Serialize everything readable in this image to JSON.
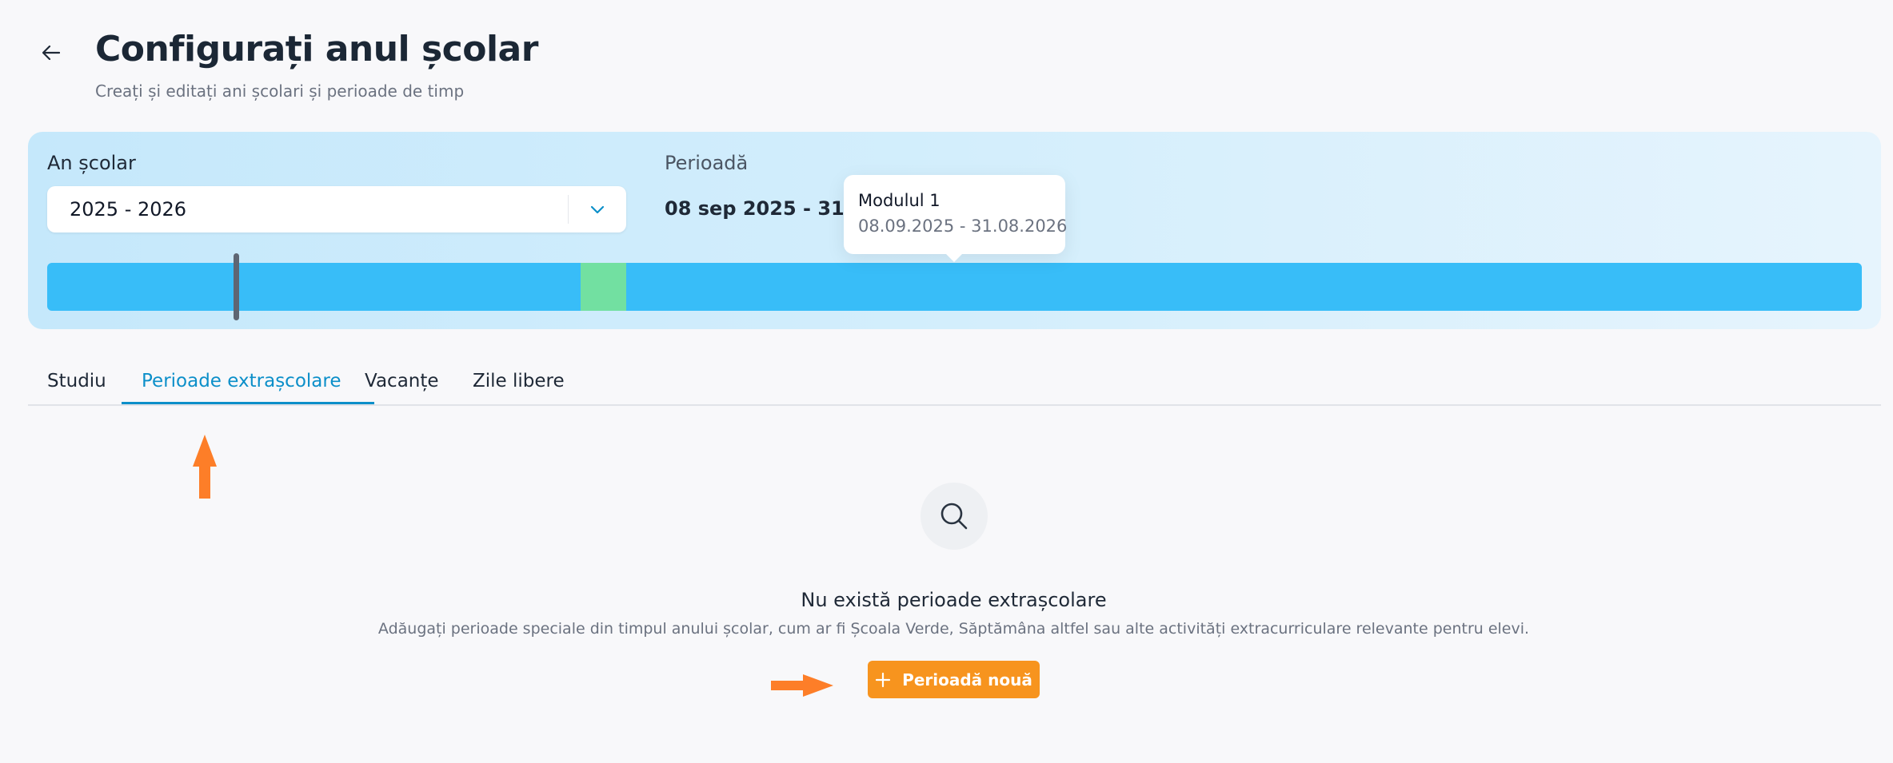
{
  "header": {
    "title": "Configurați anul școlar",
    "subtitle": "Creați și editați ani școlari și perioade de timp",
    "back_icon": "arrow-left-icon"
  },
  "hero": {
    "year_label": "An școlar",
    "year_value": "2025 - 2026",
    "period_label": "Perioadă",
    "period_value": "08 sep 2025 - 31 aug 2026",
    "tooltip": {
      "title": "Modulul 1",
      "range": "08.09.2025 - 31.08.2026"
    },
    "colors": {
      "module": "#38bdf8",
      "highlight": "#72e0a1",
      "today_marker": "#5e6673"
    }
  },
  "tabs": [
    {
      "label": "Studiu",
      "active": false
    },
    {
      "label": "Perioade extrașcolare",
      "active": true
    },
    {
      "label": "Vacanțe",
      "active": false
    },
    {
      "label": "Zile libere",
      "active": false
    }
  ],
  "empty_state": {
    "icon": "search-icon",
    "title": "Nu există perioade extrașcolare",
    "description": "Adăugați perioade speciale din timpul anului școlar, cum ar fi Școala Verde, Săptămâna altfel sau alte activități extracurriculare relevante pentru elevi.",
    "button_label": "Perioadă nouă",
    "button_color": "#f7941e"
  },
  "annotations": {
    "arrow_color": "#fd7e28"
  }
}
